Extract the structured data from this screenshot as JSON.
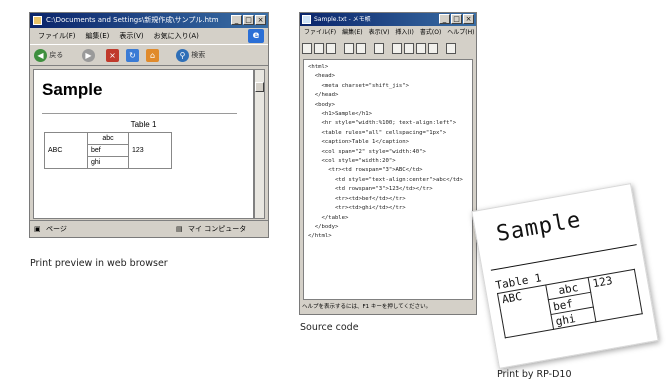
{
  "browser": {
    "title": "C:\\Documents and Settings\\新規作成\\サンプル.htm",
    "menu": [
      "ファイル(F)",
      "編集(E)",
      "表示(V)",
      "お気に入り(A)"
    ],
    "toolbar": {
      "back_label": "戻る",
      "search_label": "検索"
    },
    "status_left": "ページ",
    "status_right": "マイ コンピュータ",
    "page": {
      "heading": "Sample",
      "table_caption": "Table 1",
      "row_header": "ABC",
      "cells": [
        "abc",
        "bef",
        "ghi"
      ],
      "value": "123"
    }
  },
  "source": {
    "title": "Sample.txt - メモ帳",
    "menu": [
      "ファイル(F)",
      "編集(E)",
      "表示(V)",
      "挿入(I)",
      "書式(O)",
      "ヘルプ(H)"
    ],
    "code_lines": [
      "<html>",
      "  <head>",
      "    <meta charset=\"shift_jis\">",
      "  </head>",
      "  <body>",
      "    <h1>Sample</h1>",
      "    <hr style=\"width:%100; text-align:left\">",
      "    <table rules=\"all\" cellspacing=\"1px\">",
      "    <caption>Table 1</caption>",
      "    <col span=\"2\" style=\"width:40\">",
      "    <col style=\"width:20\">",
      "      <tr><td rowspan=\"3\">ABC</td>",
      "        <td style=\"text-align:center\">abc</td>",
      "        <td rowspan=\"3\">123</td></tr>",
      "        <tr><td>bef</td></tr>",
      "        <tr><td>ghi</td></tr>",
      "    </table>",
      "  </body>",
      "</html>"
    ],
    "status": "ヘルプを表示するには、F1 キーを押してください。"
  },
  "printed_label": {
    "heading": "Sample",
    "table_caption": "Table 1",
    "row_header": "ABC",
    "cells": [
      "abc",
      "bef",
      "ghi"
    ],
    "value": "123"
  },
  "captions": {
    "browser": "Print preview in web browser",
    "source": "Source code",
    "print": "Print by RP-D10"
  }
}
